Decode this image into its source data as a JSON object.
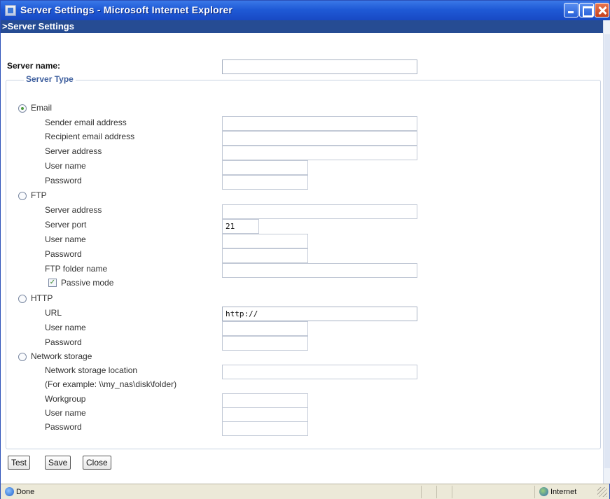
{
  "window": {
    "title": "Server Settings - Microsoft Internet Explorer"
  },
  "page": {
    "header": ">Server Settings",
    "server_name_label": "Server name:",
    "server_name_value": "",
    "server_type_legend": "Server Type"
  },
  "email": {
    "radio_label": "Email",
    "selected": true,
    "fields": {
      "sender": "Sender email address",
      "recipient": "Recipient email address",
      "server": "Server address",
      "user": "User name",
      "password": "Password"
    }
  },
  "ftp": {
    "radio_label": "FTP",
    "fields": {
      "server": "Server address",
      "port": "Server port",
      "user": "User name",
      "password": "Password",
      "folder": "FTP folder name"
    },
    "port_value": "21",
    "passive_label": "Passive mode",
    "passive_checked": true
  },
  "http": {
    "radio_label": "HTTP",
    "fields": {
      "url": "URL",
      "user": "User name",
      "password": "Password"
    },
    "url_value": "http://"
  },
  "nas": {
    "radio_label": "Network storage",
    "fields": {
      "location": "Network storage location",
      "example": "(For example: \\\\my_nas\\disk\\folder)",
      "workgroup": "Workgroup",
      "user": "User name",
      "password": "Password"
    }
  },
  "buttons": {
    "test": "Test",
    "save": "Save",
    "close": "Close"
  },
  "statusbar": {
    "status": "Done",
    "zone": "Internet"
  },
  "icons": {
    "title_icon": "ie-page-icon",
    "status_icon": "page-done-icon",
    "zone_icon": "internet-globe-icon"
  }
}
